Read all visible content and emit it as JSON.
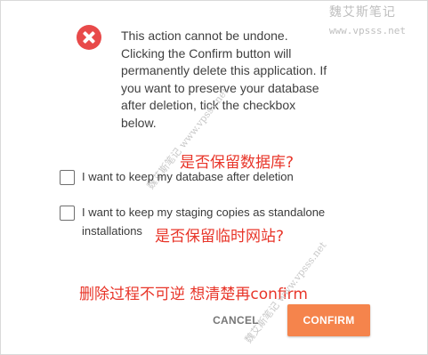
{
  "watermark": {
    "site_cn": "魏艾斯笔记",
    "site_url": "www.vpsss.net"
  },
  "icons": {
    "error": "error-x-circle-icon"
  },
  "colors": {
    "error_red": "#e84a4a",
    "annotation_red": "#e8362a",
    "confirm_orange": "#f5844c"
  },
  "message": {
    "line1": "This action cannot be undone.",
    "line2": "Clicking the Confirm button will",
    "line3": "permanently delete this application. If",
    "line4": "you want to preserve your database",
    "line5": "after deletion, tick the checkbox",
    "line6": "below."
  },
  "annotations": {
    "keep_database": "是否保留数据库?",
    "keep_staging": "是否保留临时网站?",
    "warning": "删除过程不可逆 想清楚再confirm"
  },
  "options": {
    "keep_database": {
      "label": "I want to keep my database after deletion",
      "checked": false
    },
    "keep_staging": {
      "label_line1": "I want to keep my staging copies as standalone",
      "label_line2": "installations",
      "checked": false
    }
  },
  "buttons": {
    "cancel": "CANCEL",
    "confirm": "CONFIRM"
  }
}
